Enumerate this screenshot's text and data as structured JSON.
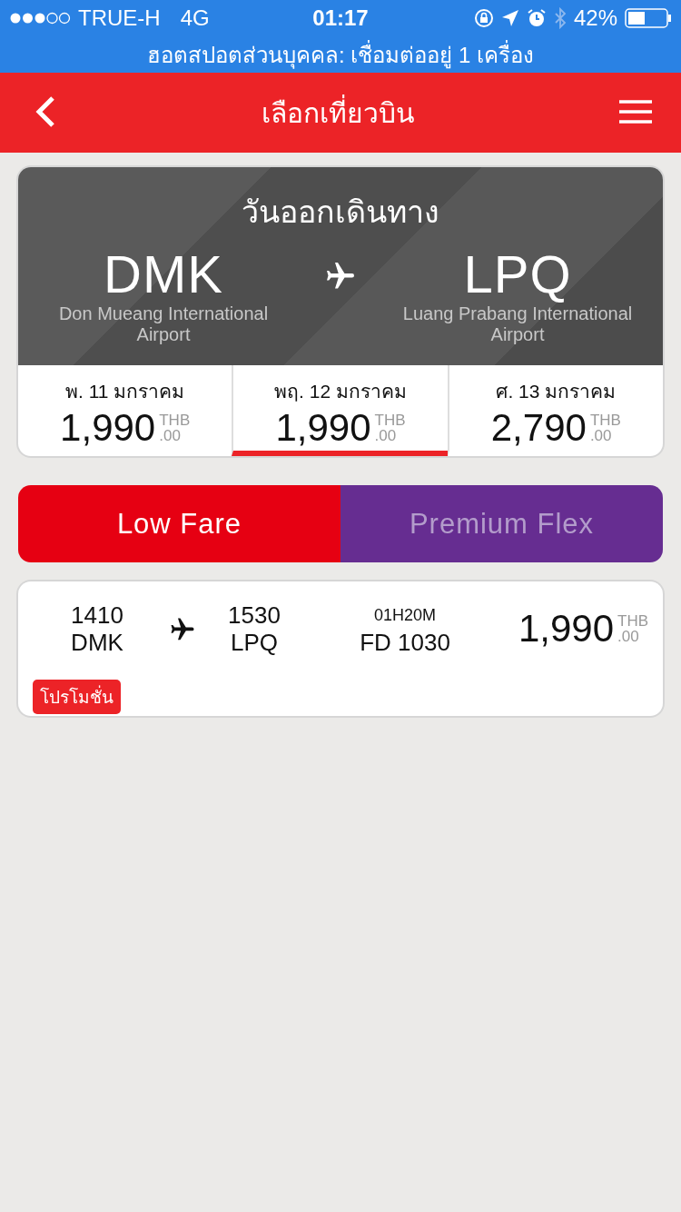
{
  "status_bar": {
    "carrier": "TRUE-H",
    "network": "4G",
    "time": "01:17",
    "battery": "42%"
  },
  "hotspot_banner": "ฮอตสปอตส่วนบุคคล: เชื่อมต่ออยู่ 1 เครื่อง",
  "header": {
    "title": "เลือกเที่ยวบิน"
  },
  "route": {
    "heading": "วันออกเดินทาง",
    "origin": {
      "code": "DMK",
      "name": "Don Mueang International Airport"
    },
    "destination": {
      "code": "LPQ",
      "name": "Luang Prabang International Airport"
    }
  },
  "dates": [
    {
      "label": "พ. 11 มกราคม",
      "price": "1,990",
      "currency": "THB",
      "decimals": ".00",
      "selected": false
    },
    {
      "label": "พฤ. 12 มกราคม",
      "price": "1,990",
      "currency": "THB",
      "decimals": ".00",
      "selected": true
    },
    {
      "label": "ศ. 13 มกราคม",
      "price": "2,790",
      "currency": "THB",
      "decimals": ".00",
      "selected": false
    }
  ],
  "fare_tabs": [
    {
      "label": "Low Fare",
      "color": "#e60012",
      "selected": true
    },
    {
      "label": "Premium Flex",
      "color": "#662d91",
      "selected": false
    }
  ],
  "flights": [
    {
      "depart_time": "1410",
      "depart_code": "DMK",
      "arrive_time": "1530",
      "arrive_code": "LPQ",
      "duration": "01H20M",
      "flight_number": "FD 1030",
      "price": "1,990",
      "currency": "THB",
      "decimals": ".00",
      "badge": "โปรโมชั่น"
    }
  ]
}
